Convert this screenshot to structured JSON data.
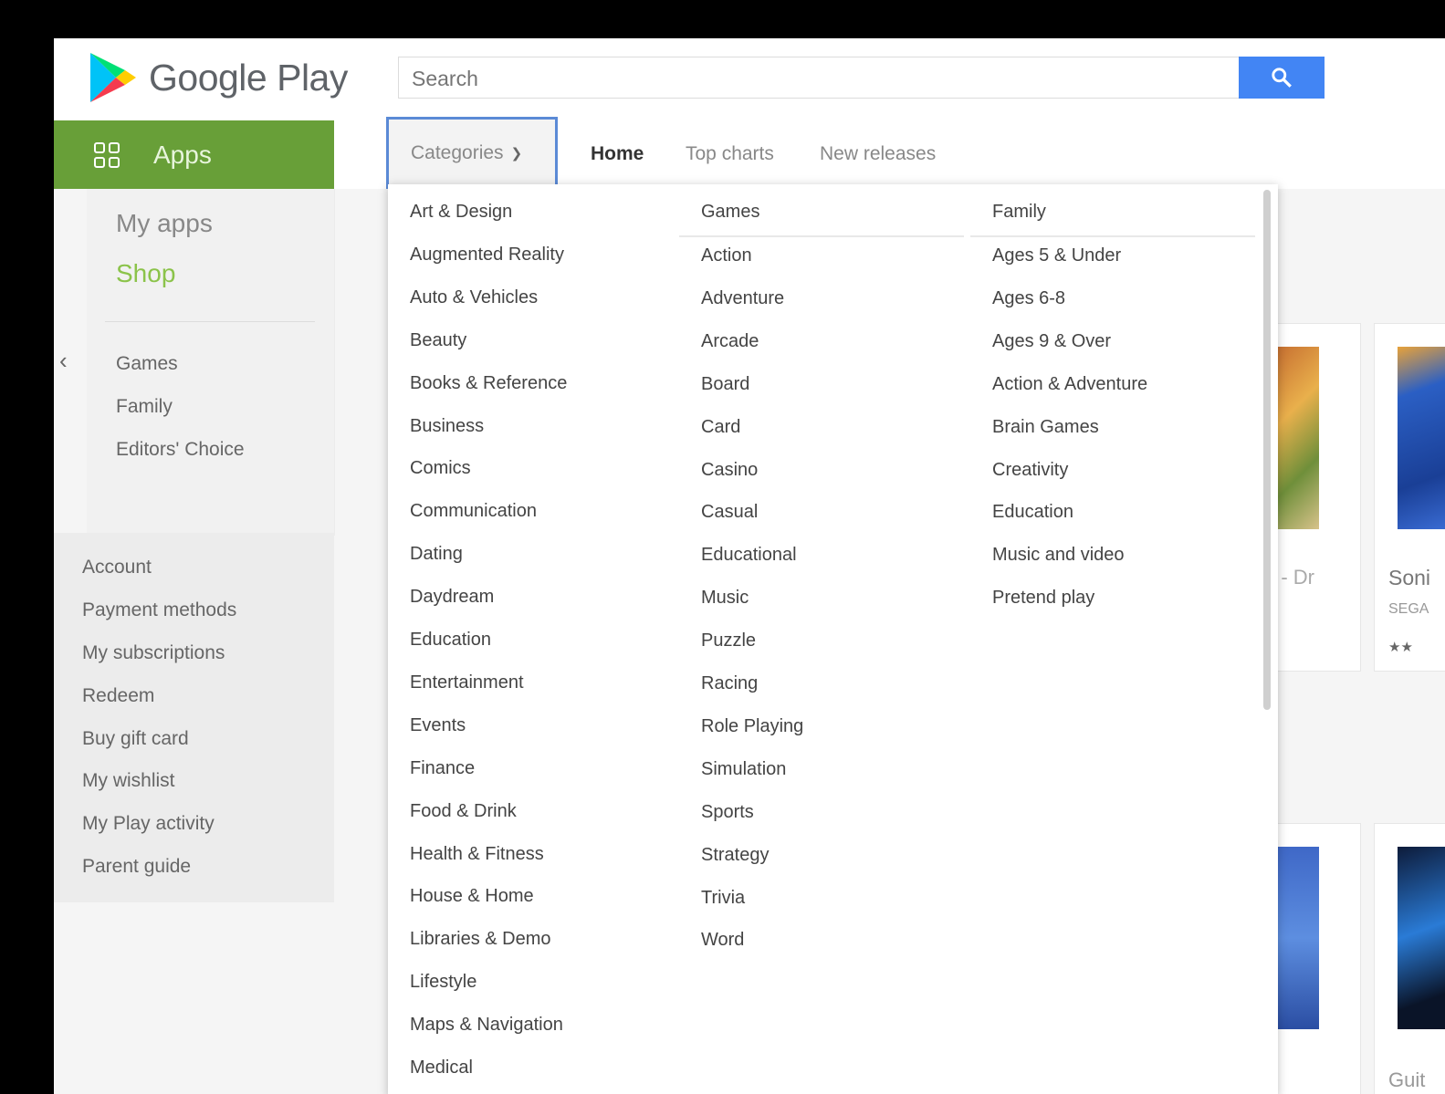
{
  "header": {
    "logo_text": "Google Play",
    "search_placeholder": "Search"
  },
  "left_nav": {
    "apps_label": "Apps",
    "my_apps": "My apps",
    "shop": "Shop",
    "sub_items": [
      "Games",
      "Family",
      "Editors' Choice"
    ],
    "account_items": [
      "Account",
      "Payment methods",
      "My subscriptions",
      "Redeem",
      "Buy gift card",
      "My wishlist",
      "My Play activity",
      "Parent guide"
    ]
  },
  "tabs": {
    "categories": "Categories",
    "home": "Home",
    "top_charts": "Top charts",
    "new_releases": "New releases"
  },
  "categories": {
    "apps": [
      "Art & Design",
      "Augmented Reality",
      "Auto & Vehicles",
      "Beauty",
      "Books & Reference",
      "Business",
      "Comics",
      "Communication",
      "Dating",
      "Daydream",
      "Education",
      "Entertainment",
      "Events",
      "Finance",
      "Food & Drink",
      "Health & Fitness",
      "House & Home",
      "Libraries & Demo",
      "Lifestyle",
      "Maps & Navigation",
      "Medical"
    ],
    "games_header": "Games",
    "games": [
      "Action",
      "Adventure",
      "Arcade",
      "Board",
      "Card",
      "Casino",
      "Casual",
      "Educational",
      "Music",
      "Puzzle",
      "Racing",
      "Role Playing",
      "Simulation",
      "Sports",
      "Strategy",
      "Trivia",
      "Word"
    ],
    "family_header": "Family",
    "family": [
      "Ages 5 & Under",
      "Ages 6-8",
      "Ages 9 & Over",
      "Action & Adventure",
      "Brain Games",
      "Creativity",
      "Education",
      "Music and video",
      "Pretend play"
    ]
  },
  "background": {
    "card1_title_fragment": "n - Dr",
    "card2_title_fragment": "Soni",
    "card2_dev_fragment": "SEGA",
    "card2_rating": "★★",
    "card4_title_fragment": "Guit"
  },
  "colors": {
    "apps_green": "#689f38",
    "shop_green": "#8bc34a",
    "search_blue": "#4285f4",
    "categories_outline": "#5b8ad6"
  }
}
